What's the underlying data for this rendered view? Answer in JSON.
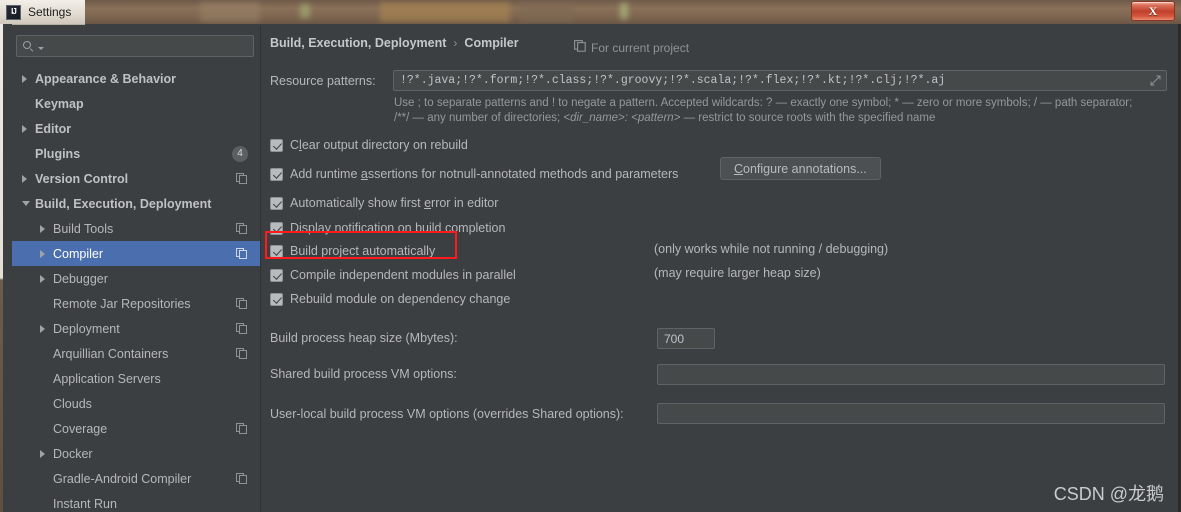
{
  "window": {
    "title": "Settings",
    "logo_text": "IJ",
    "close_label": "X"
  },
  "search": {
    "value": "",
    "placeholder": ""
  },
  "sidebar": {
    "items": [
      {
        "label": "Appearance & Behavior",
        "indent": 0,
        "arrow": "closed",
        "bold": true,
        "badge": null,
        "copy": false,
        "selected": false
      },
      {
        "label": "Keymap",
        "indent": 0,
        "arrow": "none",
        "bold": true,
        "badge": null,
        "copy": false,
        "selected": false
      },
      {
        "label": "Editor",
        "indent": 0,
        "arrow": "closed",
        "bold": true,
        "badge": null,
        "copy": false,
        "selected": false
      },
      {
        "label": "Plugins",
        "indent": 0,
        "arrow": "none",
        "bold": true,
        "badge": "4",
        "copy": false,
        "selected": false
      },
      {
        "label": "Version Control",
        "indent": 0,
        "arrow": "closed",
        "bold": true,
        "badge": null,
        "copy": true,
        "selected": false
      },
      {
        "label": "Build, Execution, Deployment",
        "indent": 0,
        "arrow": "open",
        "bold": true,
        "badge": null,
        "copy": false,
        "selected": false
      },
      {
        "label": "Build Tools",
        "indent": 1,
        "arrow": "closed",
        "bold": false,
        "badge": null,
        "copy": true,
        "selected": false
      },
      {
        "label": "Compiler",
        "indent": 1,
        "arrow": "closed",
        "bold": false,
        "badge": null,
        "copy": true,
        "selected": true
      },
      {
        "label": "Debugger",
        "indent": 1,
        "arrow": "closed",
        "bold": false,
        "badge": null,
        "copy": false,
        "selected": false
      },
      {
        "label": "Remote Jar Repositories",
        "indent": 1,
        "arrow": "none",
        "bold": false,
        "badge": null,
        "copy": true,
        "selected": false
      },
      {
        "label": "Deployment",
        "indent": 1,
        "arrow": "closed",
        "bold": false,
        "badge": null,
        "copy": true,
        "selected": false
      },
      {
        "label": "Arquillian Containers",
        "indent": 1,
        "arrow": "none",
        "bold": false,
        "badge": null,
        "copy": true,
        "selected": false
      },
      {
        "label": "Application Servers",
        "indent": 1,
        "arrow": "none",
        "bold": false,
        "badge": null,
        "copy": false,
        "selected": false
      },
      {
        "label": "Clouds",
        "indent": 1,
        "arrow": "none",
        "bold": false,
        "badge": null,
        "copy": false,
        "selected": false
      },
      {
        "label": "Coverage",
        "indent": 1,
        "arrow": "none",
        "bold": false,
        "badge": null,
        "copy": true,
        "selected": false
      },
      {
        "label": "Docker",
        "indent": 1,
        "arrow": "closed",
        "bold": false,
        "badge": null,
        "copy": false,
        "selected": false
      },
      {
        "label": "Gradle-Android Compiler",
        "indent": 1,
        "arrow": "none",
        "bold": false,
        "badge": null,
        "copy": true,
        "selected": false
      },
      {
        "label": "Instant Run",
        "indent": 1,
        "arrow": "none",
        "bold": false,
        "badge": null,
        "copy": false,
        "selected": false
      }
    ]
  },
  "content": {
    "breadcrumb_parent": "Build, Execution, Deployment",
    "breadcrumb_sep": "›",
    "breadcrumb_current": "Compiler",
    "for_current_project": "For current project",
    "resource_patterns_label": "Resource patterns:",
    "resource_patterns_value": "!?*.java;!?*.form;!?*.class;!?*.groovy;!?*.scala;!?*.flex;!?*.kt;!?*.clj;!?*.aj",
    "hint_line1_a": "Use ; to separate patterns and ! to negate a pattern. Accepted wildcards: ? — exactly one symbol; * — zero or more symbols; / — path separator;",
    "hint_line2_a": "/**/ — any number of directories;  ",
    "hint_line2_i": "<dir_name>: <pattern>",
    "hint_line2_b": " — restrict to source roots with the specified name",
    "checkboxes": [
      {
        "pre": "C",
        "mn": "l",
        "post": "ear output directory on rebuild",
        "checked": true
      },
      {
        "pre": "Add runtime ",
        "mn": "a",
        "post": "ssertions for notnull-annotated methods and parameters",
        "checked": true
      },
      {
        "pre": "Automatically show first ",
        "mn": "e",
        "post": "rror in editor",
        "checked": true
      },
      {
        "pre": "Display notification on build completion",
        "mn": "",
        "post": "",
        "checked": true
      },
      {
        "pre": "Build project automatically",
        "mn": "",
        "post": "",
        "checked": true
      },
      {
        "pre": "Compile independent modules in parallel",
        "mn": "",
        "post": "",
        "checked": true
      },
      {
        "pre": "Rebuild module on dependency change",
        "mn": "",
        "post": "",
        "checked": true
      }
    ],
    "configure_annotations_mn": "C",
    "configure_annotations_rest": "onfigure annotations...",
    "note_build_auto": "(only works while not running / debugging)",
    "note_parallel": "(may require larger heap size)",
    "heap_label": "Build process heap size (Mbytes):",
    "heap_value": "700",
    "shared_vm_label": "Shared build process VM options:",
    "shared_vm_value": "",
    "userlocal_vm_label": "User-local build process VM options (overrides Shared options):",
    "userlocal_vm_value": ""
  },
  "watermark": "CSDN @龙鹅"
}
